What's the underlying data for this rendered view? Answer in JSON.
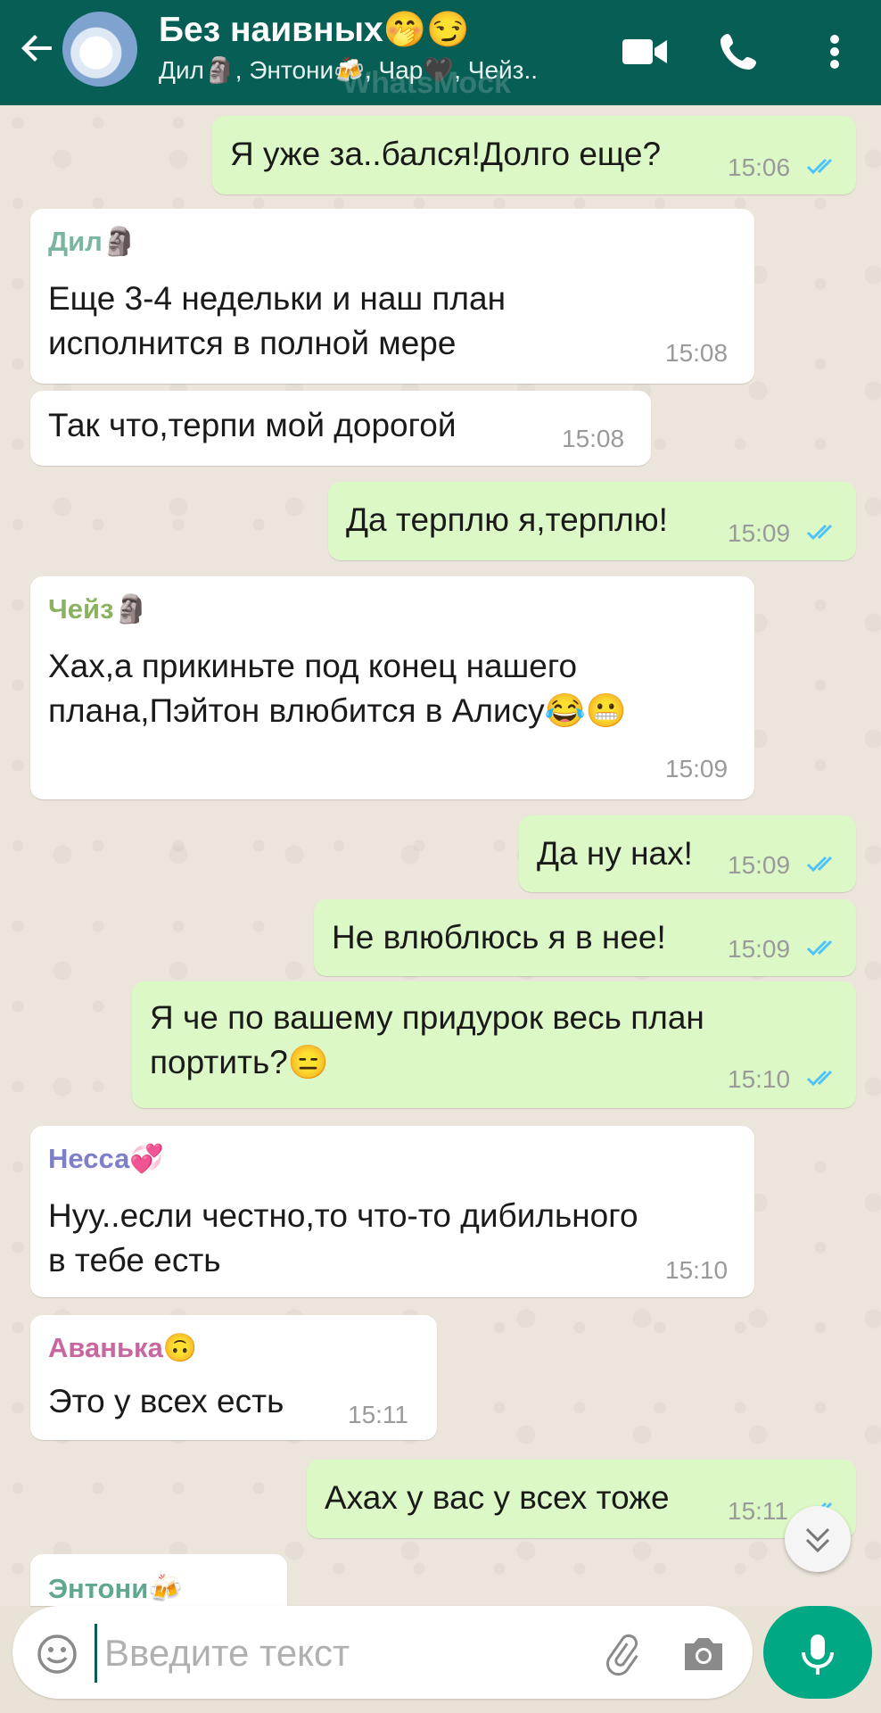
{
  "header": {
    "title": "Без наивных🤭😏",
    "subtitle": "Дил🗿, Энтони🍻, Чар🖤, Чейз..",
    "watermark": "WhatsMock"
  },
  "colors": {
    "header": "#075e54",
    "outgoing": "#dcf8c6",
    "incoming": "#ffffff",
    "read_ticks": "#4fc3f7",
    "mic_button": "#00a884"
  },
  "messages": [
    {
      "dir": "out",
      "text": "Я уже за..бался!Долго еще?",
      "time": "15:06",
      "status": "read"
    },
    {
      "dir": "in",
      "sender": "Дил🗿",
      "text": "Еще 3-4 недельки и наш план\nисполнится в полной мере",
      "time": "15:08"
    },
    {
      "dir": "in",
      "text": "Так что,терпи мой дорогой",
      "time": "15:08"
    },
    {
      "dir": "out",
      "text": "Да терплю я,терплю!",
      "time": "15:09",
      "status": "read"
    },
    {
      "dir": "in",
      "sender": "Чейз🗿",
      "text": "Хах,а прикиньте под конец нашего\nплана,Пэйтон влюбится в Алису😂😬",
      "time": "15:09"
    },
    {
      "dir": "out",
      "text": "Да ну нах!",
      "time": "15:09",
      "status": "read"
    },
    {
      "dir": "out",
      "text": "Не влюблюсь я в нее!",
      "time": "15:09",
      "status": "read"
    },
    {
      "dir": "out",
      "text": "Я че по вашему придурок весь план\nпортить?😑",
      "time": "15:10",
      "status": "read"
    },
    {
      "dir": "in",
      "sender": "Несса💞",
      "text": "Нуу..если честно,то что-то дибильного\nв тебе есть",
      "time": "15:10"
    },
    {
      "dir": "in",
      "sender": "Аванька🙃",
      "text": "Это у всех есть",
      "time": "15:11"
    },
    {
      "dir": "out",
      "text": "Ахах у вас у всех тоже",
      "time": "15:11",
      "status": "read"
    },
    {
      "dir": "in",
      "sender": "Энтони🍻",
      "text": "",
      "time": ""
    }
  ],
  "input": {
    "placeholder": "Введите текст",
    "value": ""
  },
  "icons": {
    "back": "arrow-left-icon",
    "video": "video-call-icon",
    "call": "phone-icon",
    "menu": "more-vert-icon",
    "emoji": "emoji-icon",
    "attach": "paperclip-icon",
    "camera": "camera-icon",
    "mic": "mic-icon",
    "scroll": "double-chevron-down-icon"
  }
}
